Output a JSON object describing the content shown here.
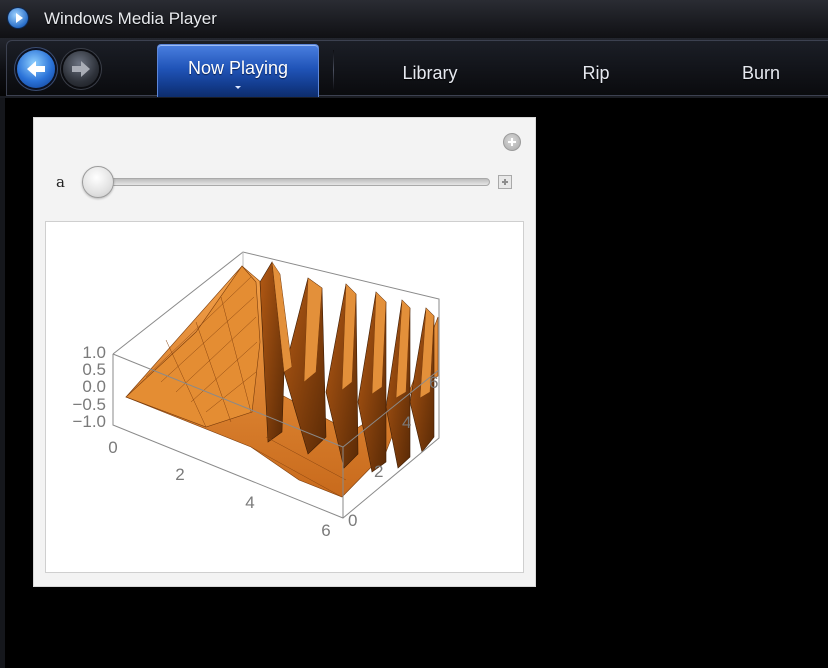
{
  "window": {
    "title": "Windows Media Player"
  },
  "nav": {
    "back_icon": "back-arrow-icon",
    "forward_icon": "forward-arrow-icon",
    "tabs": [
      {
        "label": "Now Playing",
        "active": true
      },
      {
        "label": "Library",
        "active": false
      },
      {
        "label": "Rip",
        "active": false
      },
      {
        "label": "Burn",
        "active": false
      }
    ]
  },
  "manipulate": {
    "slider_label": "a",
    "slider_value_fraction": 0.0,
    "plus_icon": "add-icon",
    "step_icon": "step-plus-icon"
  },
  "plot": {
    "z_ticks": [
      "1.0",
      "0.5",
      "0.0",
      "−0.5",
      "−1.0"
    ],
    "x_ticks": [
      "0",
      "2",
      "4",
      "6"
    ],
    "y_ticks": [
      "0",
      "2",
      "4",
      "6"
    ],
    "surface_color": "#e08a2e",
    "surface_shadow_color": "#5a2a06"
  }
}
